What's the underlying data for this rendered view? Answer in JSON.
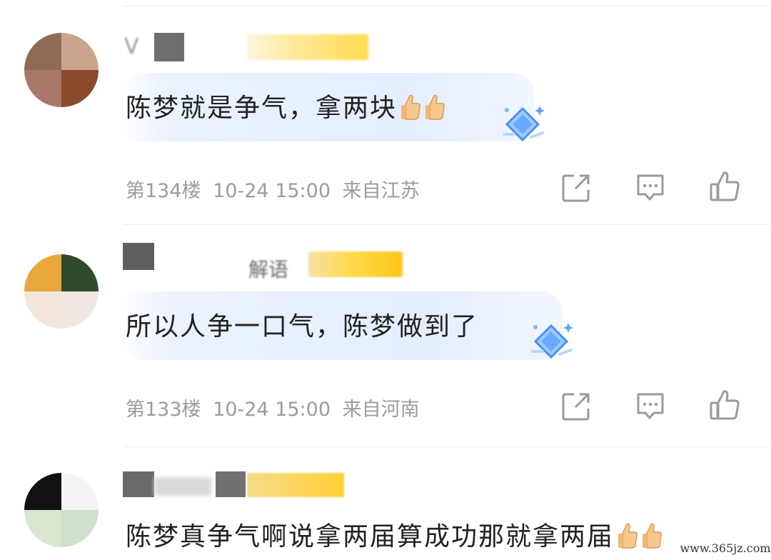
{
  "comments": [
    {
      "floor_label": "第134楼",
      "date": "10-24",
      "time": "15:00",
      "location": "来自江苏",
      "text": "陈梦就是争气，拿两块",
      "emoji_count": 2,
      "name_fragment": "V"
    },
    {
      "floor_label": "第133楼",
      "date": "10-24",
      "time": "15:00",
      "location": "来自河南",
      "text": "所以人争一口气，陈梦做到了",
      "emoji_count": 0,
      "name_fragment": "解语"
    },
    {
      "floor_label": "",
      "date": "",
      "time": "",
      "location": "",
      "text": "陈梦真争气啊说拿两届算成功那就拿两届",
      "emoji_count": 2,
      "name_fragment": ""
    }
  ],
  "icons": {
    "share": "share-icon",
    "reply": "comment-icon",
    "like": "thumbs-up-icon",
    "emoji": "thumbs-up-emoji",
    "gem": "diamond-badge-icon"
  },
  "colors": {
    "text": "#222222",
    "meta": "#9c9c9c",
    "bubble": "#e4eeff",
    "badge_yellow": "#ffd43b"
  },
  "watermark": "www.365jz.com"
}
